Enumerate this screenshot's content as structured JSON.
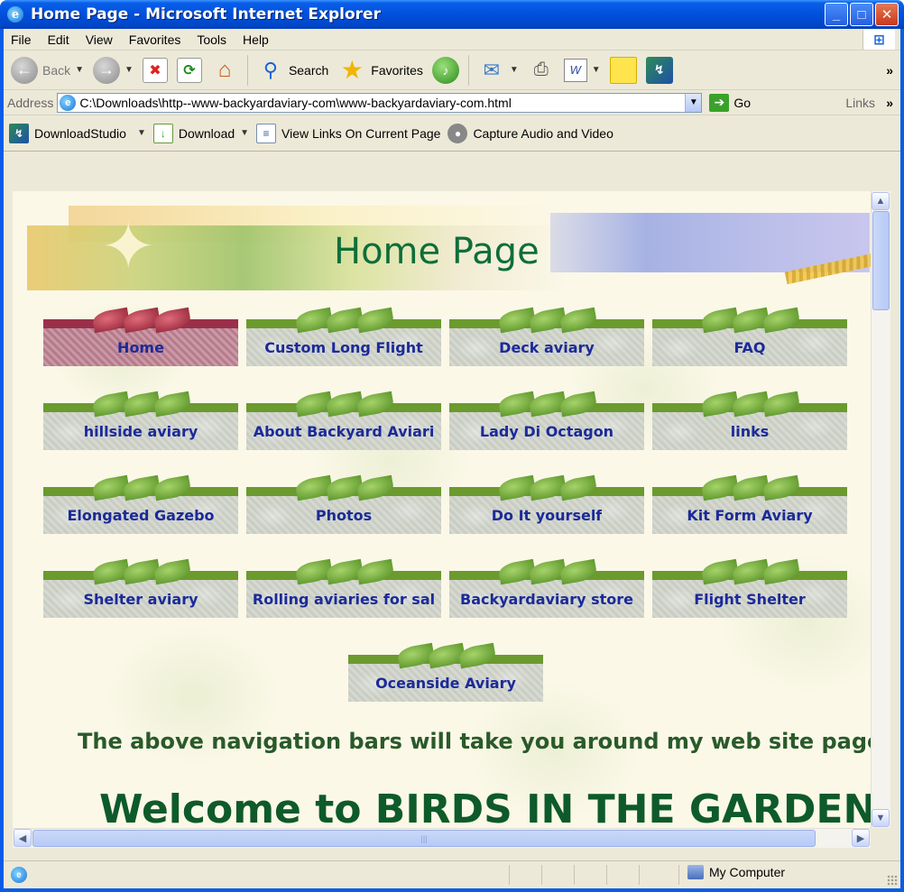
{
  "window": {
    "title": "Home Page - Microsoft Internet Explorer",
    "icon": "ie-icon"
  },
  "menubar": {
    "items": [
      "File",
      "Edit",
      "View",
      "Favorites",
      "Tools",
      "Help"
    ]
  },
  "toolbar": {
    "back_label": "Back",
    "search_label": "Search",
    "favorites_label": "Favorites"
  },
  "addressbar": {
    "label": "Address",
    "url": "C:\\Downloads\\http--www-backyardaviary-com\\www-backyardaviary-com.html",
    "go_label": "Go",
    "links_label": "Links"
  },
  "downloadbar": {
    "items": [
      {
        "label": "DownloadStudio",
        "icon": "downloadstudio-icon"
      },
      {
        "label": "Download",
        "icon": "download-icon"
      },
      {
        "label": "View Links On Current Page",
        "icon": "view-links-icon"
      },
      {
        "label": "Capture Audio and Video",
        "icon": "capture-icon"
      }
    ]
  },
  "page": {
    "banner_title": "Home Page",
    "nav": [
      {
        "label": "Home",
        "active": true
      },
      {
        "label": "Custom Long Flight",
        "active": false
      },
      {
        "label": "Deck aviary",
        "active": false
      },
      {
        "label": "FAQ",
        "active": false
      },
      {
        "label": "hillside aviary",
        "active": false
      },
      {
        "label": "About Backyard Aviari",
        "active": false
      },
      {
        "label": "Lady Di Octagon",
        "active": false
      },
      {
        "label": "links",
        "active": false
      },
      {
        "label": "Elongated Gazebo",
        "active": false
      },
      {
        "label": "Photos",
        "active": false
      },
      {
        "label": "Do It yourself",
        "active": false
      },
      {
        "label": "Kit Form Aviary",
        "active": false
      },
      {
        "label": "Shelter aviary",
        "active": false
      },
      {
        "label": "Rolling aviaries for sal",
        "active": false
      },
      {
        "label": "Backyardaviary store",
        "active": false
      },
      {
        "label": "Flight Shelter",
        "active": false
      },
      {
        "label": "Oceanside Aviary",
        "active": false
      }
    ],
    "tagline": "The above navigation bars will take you around my web site pages",
    "welcome": "Welcome to BIRDS IN THE GARDEN"
  },
  "statusbar": {
    "zone": "My Computer"
  },
  "colors": {
    "titlebar": "#0050dc",
    "nav_text": "#1b2a9a",
    "heading_green": "#0e6e3a"
  }
}
